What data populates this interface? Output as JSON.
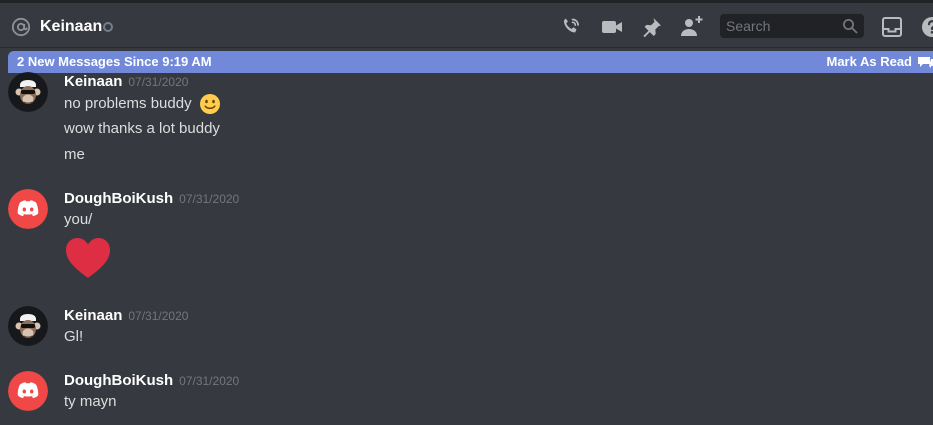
{
  "header": {
    "channel_name": "Keinaan",
    "search_placeholder": "Search",
    "icons": [
      "at-icon",
      "status-dot",
      "call-icon",
      "video-icon",
      "pin-icon",
      "add-friend-icon",
      "search-icon",
      "inbox-icon",
      "help-icon"
    ]
  },
  "banner": {
    "text": "2 New Messages Since 9:19 AM",
    "action": "Mark As Read",
    "color": "#7289da"
  },
  "messages": [
    {
      "user": "Keinaan",
      "timestamp": "07/31/2020",
      "lines": [
        "no problems buddy",
        "wow thanks a lot buddy",
        "me"
      ]
    },
    {
      "user": "DoughBoiKush",
      "timestamp": "07/31/2020",
      "lines": [
        "you/"
      ]
    },
    {
      "user": "Keinaan",
      "timestamp": "07/31/2020",
      "lines": [
        "Gl!"
      ]
    },
    {
      "user": "DoughBoiKush",
      "timestamp": "07/31/2020",
      "lines": [
        "ty mayn"
      ]
    }
  ],
  "colors": {
    "background": "#36393f",
    "discord_red": "#f04747",
    "heart": "#dd2e44"
  }
}
